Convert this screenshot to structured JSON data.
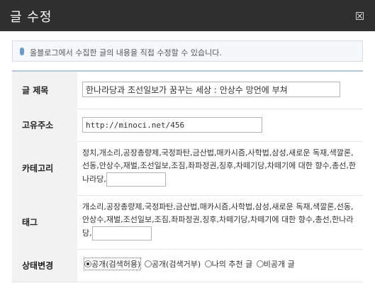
{
  "dialog": {
    "title": "글 수정",
    "close_icon": "close-icon"
  },
  "notice": {
    "text": "올블로그에서 수집한 글의 내용을 직접 수정할 수 있습니다."
  },
  "fields": {
    "title": {
      "label": "글 제목",
      "value": "한나라당과 조선일보가 꿈꾸는 세상 : 안상수 망언에 부쳐"
    },
    "url": {
      "label": "고유주소",
      "value": "http://minoci.net/456"
    },
    "category": {
      "label": "카테고리",
      "text": "정치,개소리,공장총량제,국정파탄,금산법,매카시즘,사학법,삼성,새로운 독재,색깔론,선동,안상수,재벌,조선일보,조짐,좌파정권,징후,차떼기당,차떼기에 대한 향수,총선,한나라당,"
    },
    "tags": {
      "label": "태그",
      "text": "개소리,공장총량제,국정파탄,금산법,매카시즘,사학법,삼성,새로운 독재,색깔론,선동,안상수,재벌,조선일보,조짐,좌파정권,징후,차떼기당,차떼기에 대한 향수,총선,한나라당,"
    },
    "status": {
      "label": "상태변경",
      "options": [
        "공개(검색허용)",
        "공개(검색거부)",
        "나의 추천 글",
        "비공개 글"
      ],
      "selected": "공개(검색허용)"
    }
  }
}
